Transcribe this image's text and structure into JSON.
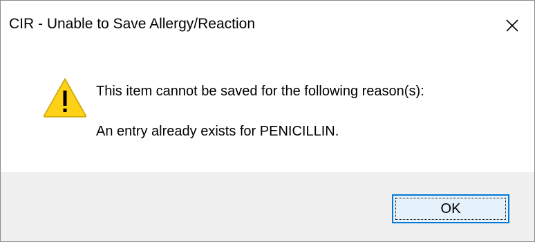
{
  "window": {
    "title": "CIR - Unable to Save Allergy/Reaction",
    "close_icon": "close-icon"
  },
  "message": {
    "icon": "warning-icon",
    "icon_color": "#FCD116",
    "line1": "This item cannot be saved for the following reason(s):",
    "line2": "An entry already exists for PENICILLIN."
  },
  "buttons": {
    "ok_label": "OK",
    "accent_color": "#0078D7"
  }
}
